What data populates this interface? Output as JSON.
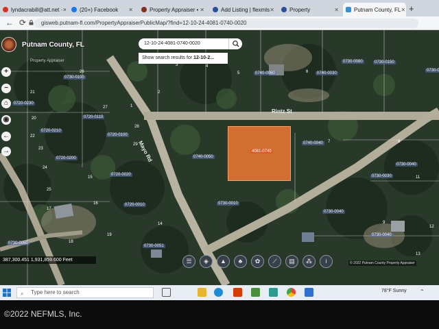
{
  "browser": {
    "tabs": [
      {
        "title": "lyndacrabill@att.net ·",
        "color": "#d93025"
      },
      {
        "title": "(20+) Facebook",
        "color": "#1877f2"
      },
      {
        "title": "Property Appraiser • ",
        "color": "#8a2c1c"
      },
      {
        "title": "Add Listing | flexmls ",
        "color": "#2a4f9e"
      },
      {
        "title": "Property",
        "color": "#2a4f9e"
      },
      {
        "title": "Putnam County, FL",
        "color": "#3a8fd0"
      }
    ],
    "url": "gisweb.putnam-fl.com/PropertyAppraiserPublicMap/?find=12-10-24-4081-0740-0020"
  },
  "map": {
    "county_title": "Putnam County, FL",
    "subtitle": "Property Appraiser",
    "search_value": "12-10-24-4081-0740-0020",
    "suggestion_prefix": "Show search results for ",
    "suggestion_term": "12-10-2...",
    "selected_parcel_label": "4081-0740",
    "road_labels": {
      "rintz": "Rintz St",
      "mayo": "Mayo Rd"
    },
    "coord_readout": "387,300.451 1,931,859.600 Feet",
    "attribution": "© 2022 Putnam County Property Appraiser",
    "parcel_labels": [
      "0730-0100",
      "0720-0230",
      "0720-0110",
      "0720-0210",
      "0720-0100",
      "0720-0200",
      "0720-0020",
      "0720-0010",
      "0740-0040",
      "0740-0050",
      "0730-0040",
      "0730-0030",
      "0730-0010",
      "0730-0080",
      "0730-0150",
      "0740-0030",
      "0740-0060",
      "0730-0010",
      "0730-0040",
      "0730-0051",
      "0730-0050",
      "0730-0040"
    ],
    "lot_numbers": [
      "20",
      "21",
      "22",
      "23",
      "24",
      "25",
      "26",
      "27",
      "28",
      "29",
      "5",
      "4",
      "3",
      "2",
      "1",
      "6",
      "7",
      "8",
      "9",
      "11",
      "12",
      "13",
      "14",
      "15",
      "16",
      "17",
      "18",
      "19"
    ]
  },
  "taskbar": {
    "search_placeholder": "Type here to search",
    "weather": "78°F  Sunny"
  },
  "bezel": {
    "copyright": "©2022 NEFMLS, Inc."
  },
  "icons": [
    "back-arrow-icon",
    "reload-icon",
    "lock-icon",
    "search-icon",
    "zoom-in-icon",
    "zoom-out-icon",
    "home-icon",
    "locate-icon",
    "back-icon",
    "forward-icon",
    "layers-icon",
    "windows-logo-icon"
  ]
}
